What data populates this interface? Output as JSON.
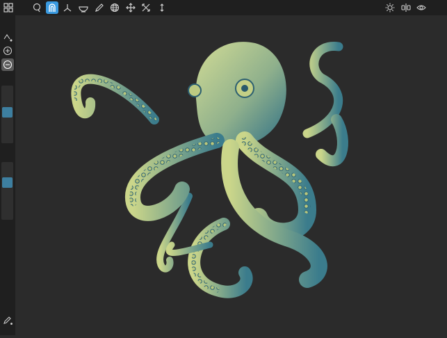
{
  "app": {
    "colors": {
      "toolbar_bg": "#1f1f1f",
      "canvas_bg": "#2b2b2b",
      "accent": "#3a9ae0",
      "slider_thumb": "#3d7fa0",
      "model_light": "#c9d48a",
      "model_dark": "#2e6f86"
    }
  },
  "toolbar": {
    "left_icons": [
      "grid-icon",
      "lasso-icon",
      "magnet-icon",
      "axes-icon",
      "bowl-icon",
      "pencil-icon",
      "globe-icon",
      "transform-icon",
      "expand-icon",
      "symmetry-vertical-icon"
    ],
    "active_tool": "magnet-icon",
    "right_icons": [
      "sun-icon",
      "mirror-icon",
      "eye-icon"
    ]
  },
  "sidebar": {
    "tools": [
      "vertex-mode-icon",
      "add-icon",
      "subtract-icon"
    ],
    "pressed": "subtract-icon",
    "sliders": [
      {
        "name": "brush-size-slider",
        "value": 0.45
      },
      {
        "name": "brush-strength-slider",
        "value": 0.33
      }
    ],
    "bottom_tool": "edit-icon"
  },
  "model": {
    "subject": "octopus-sculpt"
  }
}
